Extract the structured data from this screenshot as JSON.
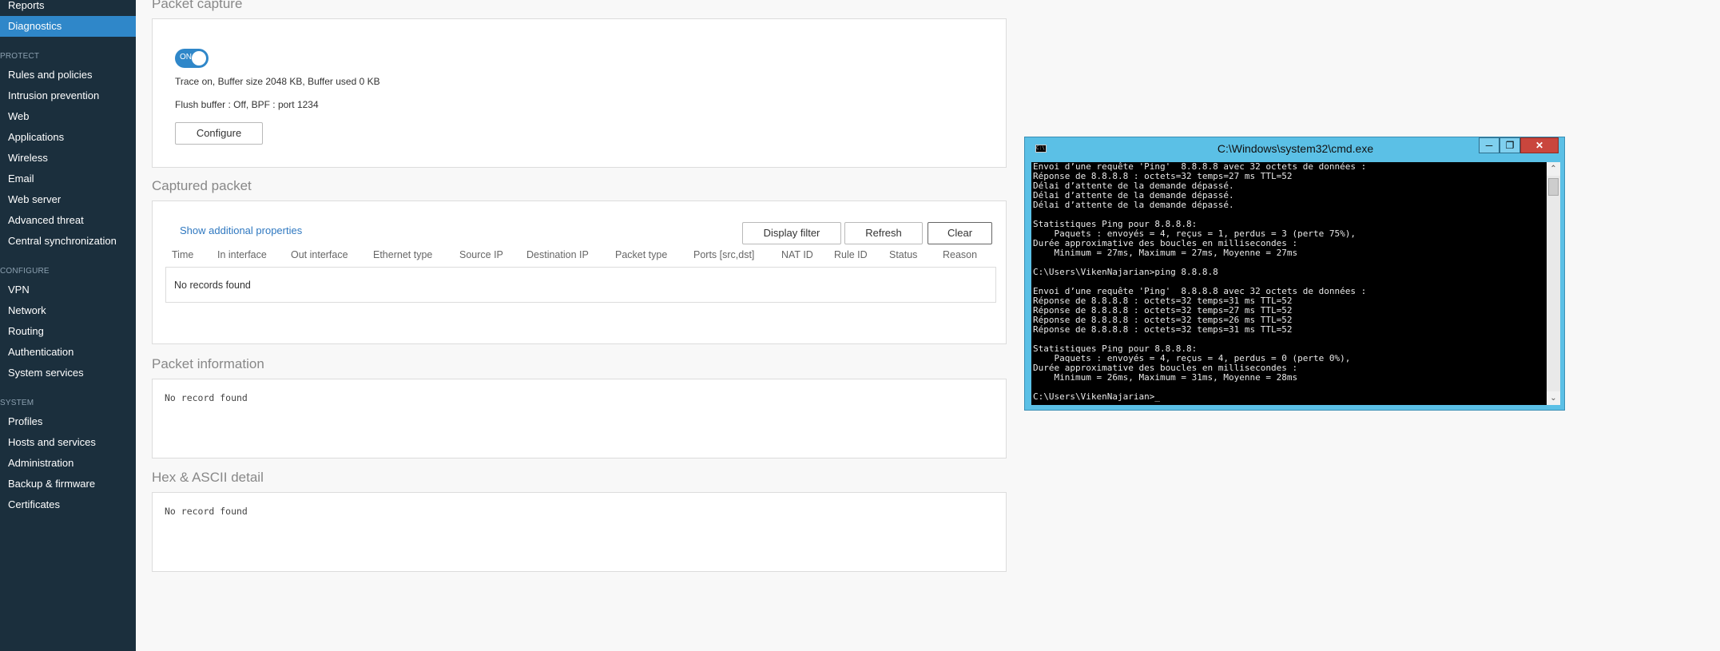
{
  "sidebar": {
    "top_items": [
      {
        "label": "Reports"
      },
      {
        "label": "Diagnostics",
        "active": true
      }
    ],
    "sections": [
      {
        "title": "PROTECT",
        "items": [
          "Rules and policies",
          "Intrusion prevention",
          "Web",
          "Applications",
          "Wireless",
          "Email",
          "Web server",
          "Advanced threat",
          "Central synchronization"
        ]
      },
      {
        "title": "CONFIGURE",
        "items": [
          "VPN",
          "Network",
          "Routing",
          "Authentication",
          "System services"
        ]
      },
      {
        "title": "SYSTEM",
        "items": [
          "Profiles",
          "Hosts and services",
          "Administration",
          "Backup & firmware",
          "Certificates"
        ]
      }
    ]
  },
  "packet_capture": {
    "title": "Packet capture",
    "toggle_label": "ON",
    "status_line": "Trace on, Buffer size 2048 KB, Buffer used 0 KB",
    "flush_line": "Flush buffer : Off, BPF : port 1234",
    "configure_button": "Configure"
  },
  "captured_packet": {
    "title": "Captured packet",
    "show_additional": "Show additional properties",
    "buttons": {
      "display_filter": "Display filter",
      "refresh": "Refresh",
      "clear": "Clear"
    },
    "columns": [
      "Time",
      "In interface",
      "Out interface",
      "Ethernet type",
      "Source IP",
      "Destination IP",
      "Packet type",
      "Ports [src,dst]",
      "NAT ID",
      "Rule ID",
      "Status",
      "Reason"
    ],
    "empty_text": "No records found"
  },
  "packet_information": {
    "title": "Packet information",
    "empty_text": "No record found"
  },
  "hex_ascii": {
    "title": "Hex & ASCII detail",
    "empty_text": "No record found"
  },
  "cmd_window": {
    "title": "C:\\Windows\\system32\\cmd.exe",
    "icon": "C:\\",
    "lines": [
      "Envoi d’une requête 'Ping'  8.8.8.8 avec 32 octets de données :",
      "Réponse de 8.8.8.8 : octets=32 temps=27 ms TTL=52",
      "Délai d’attente de la demande dépassé.",
      "Délai d’attente de la demande dépassé.",
      "Délai d’attente de la demande dépassé.",
      "",
      "Statistiques Ping pour 8.8.8.8:",
      "    Paquets : envoyés = 4, reçus = 1, perdus = 3 (perte 75%),",
      "Durée approximative des boucles en millisecondes :",
      "    Minimum = 27ms, Maximum = 27ms, Moyenne = 27ms",
      "",
      "C:\\Users\\VikenNajarian>ping 8.8.8.8",
      "",
      "Envoi d’une requête 'Ping'  8.8.8.8 avec 32 octets de données :",
      "Réponse de 8.8.8.8 : octets=32 temps=31 ms TTL=52",
      "Réponse de 8.8.8.8 : octets=32 temps=27 ms TTL=52",
      "Réponse de 8.8.8.8 : octets=32 temps=26 ms TTL=52",
      "Réponse de 8.8.8.8 : octets=32 temps=31 ms TTL=52",
      "",
      "Statistiques Ping pour 8.8.8.8:",
      "    Paquets : envoyés = 4, reçus = 4, perdus = 0 (perte 0%),",
      "Durée approximative des boucles en millisecondes :",
      "    Minimum = 26ms, Maximum = 31ms, Moyenne = 28ms",
      "",
      "C:\\Users\\VikenNajarian>_"
    ]
  },
  "colors": {
    "sidebar_bg": "#1b2f3d",
    "accent": "#2f87c9",
    "cmd_frame": "#5bc0e6",
    "close_button": "#c9463d"
  }
}
